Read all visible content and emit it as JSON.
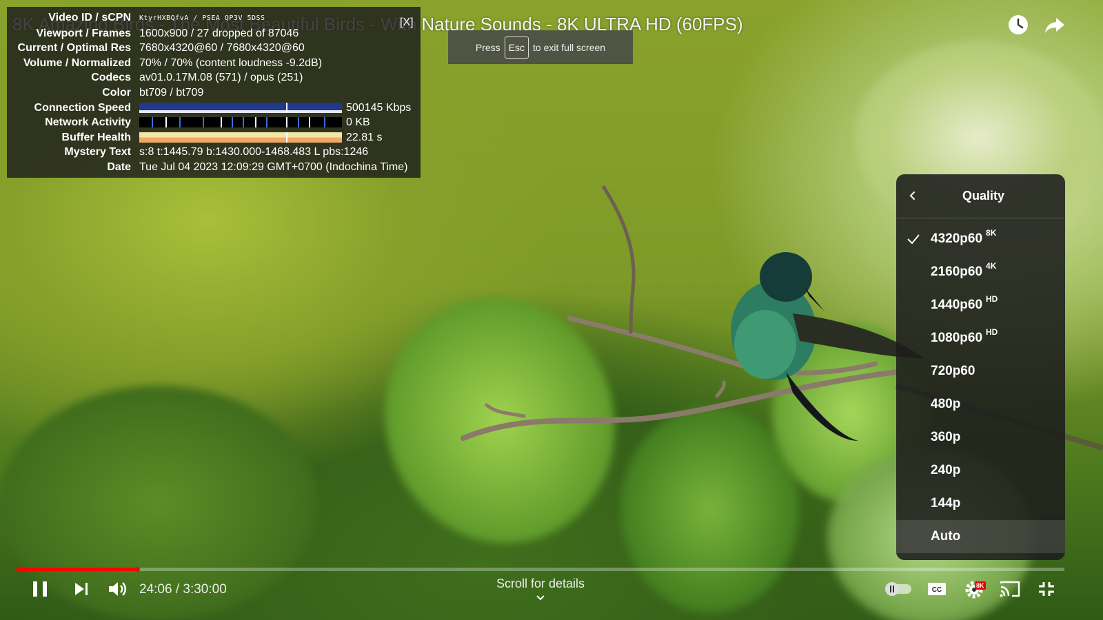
{
  "video": {
    "title": "8K Amazing Birds - The Most Beautiful Birds - With Nature Sounds - 8K ULTRA HD (60FPS)"
  },
  "stats": {
    "close_label": "[X]",
    "rows": [
      {
        "key": "Video ID / sCPN",
        "value": "KtyrHXBQfvA / PSEA QP3V 5DSS"
      },
      {
        "key": "Viewport / Frames",
        "value": "1600x900 / 27 dropped of 87046"
      },
      {
        "key": "Current / Optimal Res",
        "value": "7680x4320@60 / 7680x4320@60"
      },
      {
        "key": "Volume / Normalized",
        "value": "70% / 70% (content loudness -9.2dB)"
      },
      {
        "key": "Codecs",
        "value": "av01.0.17M.08 (571) / opus (251)"
      },
      {
        "key": "Color",
        "value": "bt709 / bt709"
      },
      {
        "key": "Connection Speed",
        "value": "500145 Kbps"
      },
      {
        "key": "Network Activity",
        "value": "0 KB"
      },
      {
        "key": "Buffer Health",
        "value": "22.81 s"
      },
      {
        "key": "Mystery Text",
        "value": "s:8 t:1445.79 b:1430.000-1468.483 L pbs:1246"
      },
      {
        "key": "Date",
        "value": "Tue Jul 04 2023 12:09:29 GMT+0700 (Indochina Time)"
      }
    ]
  },
  "fullscreen_hint": {
    "prefix": "Press",
    "key": "Esc",
    "suffix": "to exit full screen"
  },
  "quality_menu": {
    "title": "Quality",
    "items": [
      {
        "label": "4320p60",
        "badge": "8K",
        "selected": true
      },
      {
        "label": "2160p60",
        "badge": "4K",
        "selected": false
      },
      {
        "label": "1440p60",
        "badge": "HD",
        "selected": false
      },
      {
        "label": "1080p60",
        "badge": "HD",
        "selected": false
      },
      {
        "label": "720p60",
        "badge": "",
        "selected": false
      },
      {
        "label": "480p",
        "badge": "",
        "selected": false
      },
      {
        "label": "360p",
        "badge": "",
        "selected": false
      },
      {
        "label": "240p",
        "badge": "",
        "selected": false
      },
      {
        "label": "144p",
        "badge": "",
        "selected": false
      },
      {
        "label": "Auto",
        "badge": "",
        "selected": false
      }
    ]
  },
  "player": {
    "time": "24:06 / 3:30:00",
    "progress_fraction": 0.115,
    "scroll_hint": "Scroll for details",
    "settings_badge": "8K",
    "accent_color": "#ff0000"
  },
  "icons": {
    "top": [
      "clock-icon",
      "share-icon"
    ],
    "controls": [
      "pause-icon",
      "next-icon",
      "volume-icon",
      "autoplay-toggle-icon",
      "captions-icon",
      "settings-icon",
      "cast-icon",
      "exit-fullscreen-icon"
    ]
  }
}
